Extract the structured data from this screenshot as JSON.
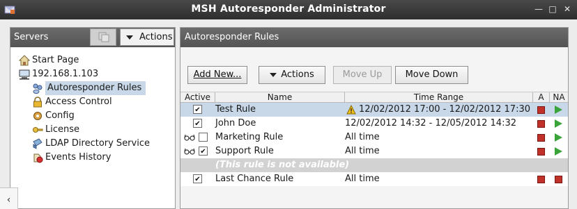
{
  "window": {
    "title": "MSH Autoresponder Administrator"
  },
  "servers_pane": {
    "title": "Servers",
    "actions_label": "Actions",
    "tree": [
      {
        "label": "Start Page",
        "icon": "home-icon"
      },
      {
        "label": "192.168.1.103",
        "icon": "computer-icon"
      },
      {
        "label": "Autoresponder Rules",
        "icon": "people-icon",
        "selected": true
      },
      {
        "label": "Access Control",
        "icon": "lock-icon"
      },
      {
        "label": "Config",
        "icon": "gear-icon"
      },
      {
        "label": "License",
        "icon": "key-icon"
      },
      {
        "label": "LDAP Directory Service",
        "icon": "directory-icon"
      },
      {
        "label": "Events History",
        "icon": "events-icon"
      }
    ]
  },
  "rules_pane": {
    "title": "Autoresponder Rules",
    "buttons": {
      "add_new": "Add New...",
      "actions": "Actions",
      "move_up": "Move Up",
      "move_down": "Move Down"
    },
    "columns": [
      "Active",
      "Name",
      "Time Range",
      "A",
      "NA"
    ],
    "rows": [
      {
        "active": true,
        "name": "Test Rule",
        "time_range": "12/02/2012 17:00 - 12/02/2012 17:30",
        "warning": true,
        "a": "stop",
        "na": "play",
        "selected": true
      },
      {
        "active": true,
        "name": "John Doe",
        "time_range": "12/02/2012 14:32 - 12/05/2012 14:32",
        "a": "stop",
        "na": "play"
      },
      {
        "active": false,
        "name": "Marketing Rule",
        "time_range": "All time",
        "glasses": true,
        "a": "stop",
        "na": "play"
      },
      {
        "active": true,
        "name": "Support Rule",
        "time_range": "All time",
        "glasses": true,
        "a": "stop",
        "na": "play"
      },
      {
        "unavailable": true,
        "text": "(This rule is not available)"
      },
      {
        "active": true,
        "name": "Last Chance Rule",
        "time_range": "All time",
        "a": "stop",
        "na": "stop"
      }
    ]
  },
  "colors": {
    "title_bar": "#3a3a3a",
    "selection": "#c8d8e8",
    "stop_red": "#c0312a",
    "play_green": "#3aa33a"
  }
}
